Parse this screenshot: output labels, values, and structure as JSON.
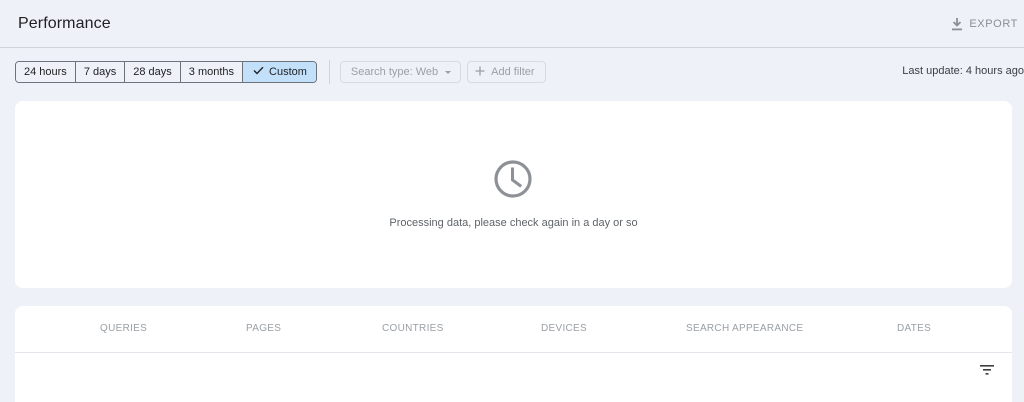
{
  "header": {
    "title": "Performance",
    "export_label": "EXPORT",
    "export_icon": "download-icon"
  },
  "filters": {
    "date_ranges": [
      {
        "label": "24 hours",
        "selected": false
      },
      {
        "label": "7 days",
        "selected": false
      },
      {
        "label": "28 days",
        "selected": false
      },
      {
        "label": "3 months",
        "selected": false
      },
      {
        "label": "Custom",
        "selected": true
      }
    ],
    "search_type_label": "Search type: Web",
    "add_filter_label": "Add filter",
    "last_update": "Last update: 4 hours ago"
  },
  "status": {
    "icon": "clock-icon",
    "message": "Processing data, please check again in a day or so"
  },
  "tabs": {
    "items": [
      "QUERIES",
      "PAGES",
      "COUNTRIES",
      "DEVICES",
      "SEARCH APPEARANCE",
      "DATES"
    ],
    "filter_icon": "filter-list-icon"
  },
  "colors": {
    "background": "#eef2f8",
    "selected_chip": "#c3e0fb",
    "card": "#ffffff"
  }
}
